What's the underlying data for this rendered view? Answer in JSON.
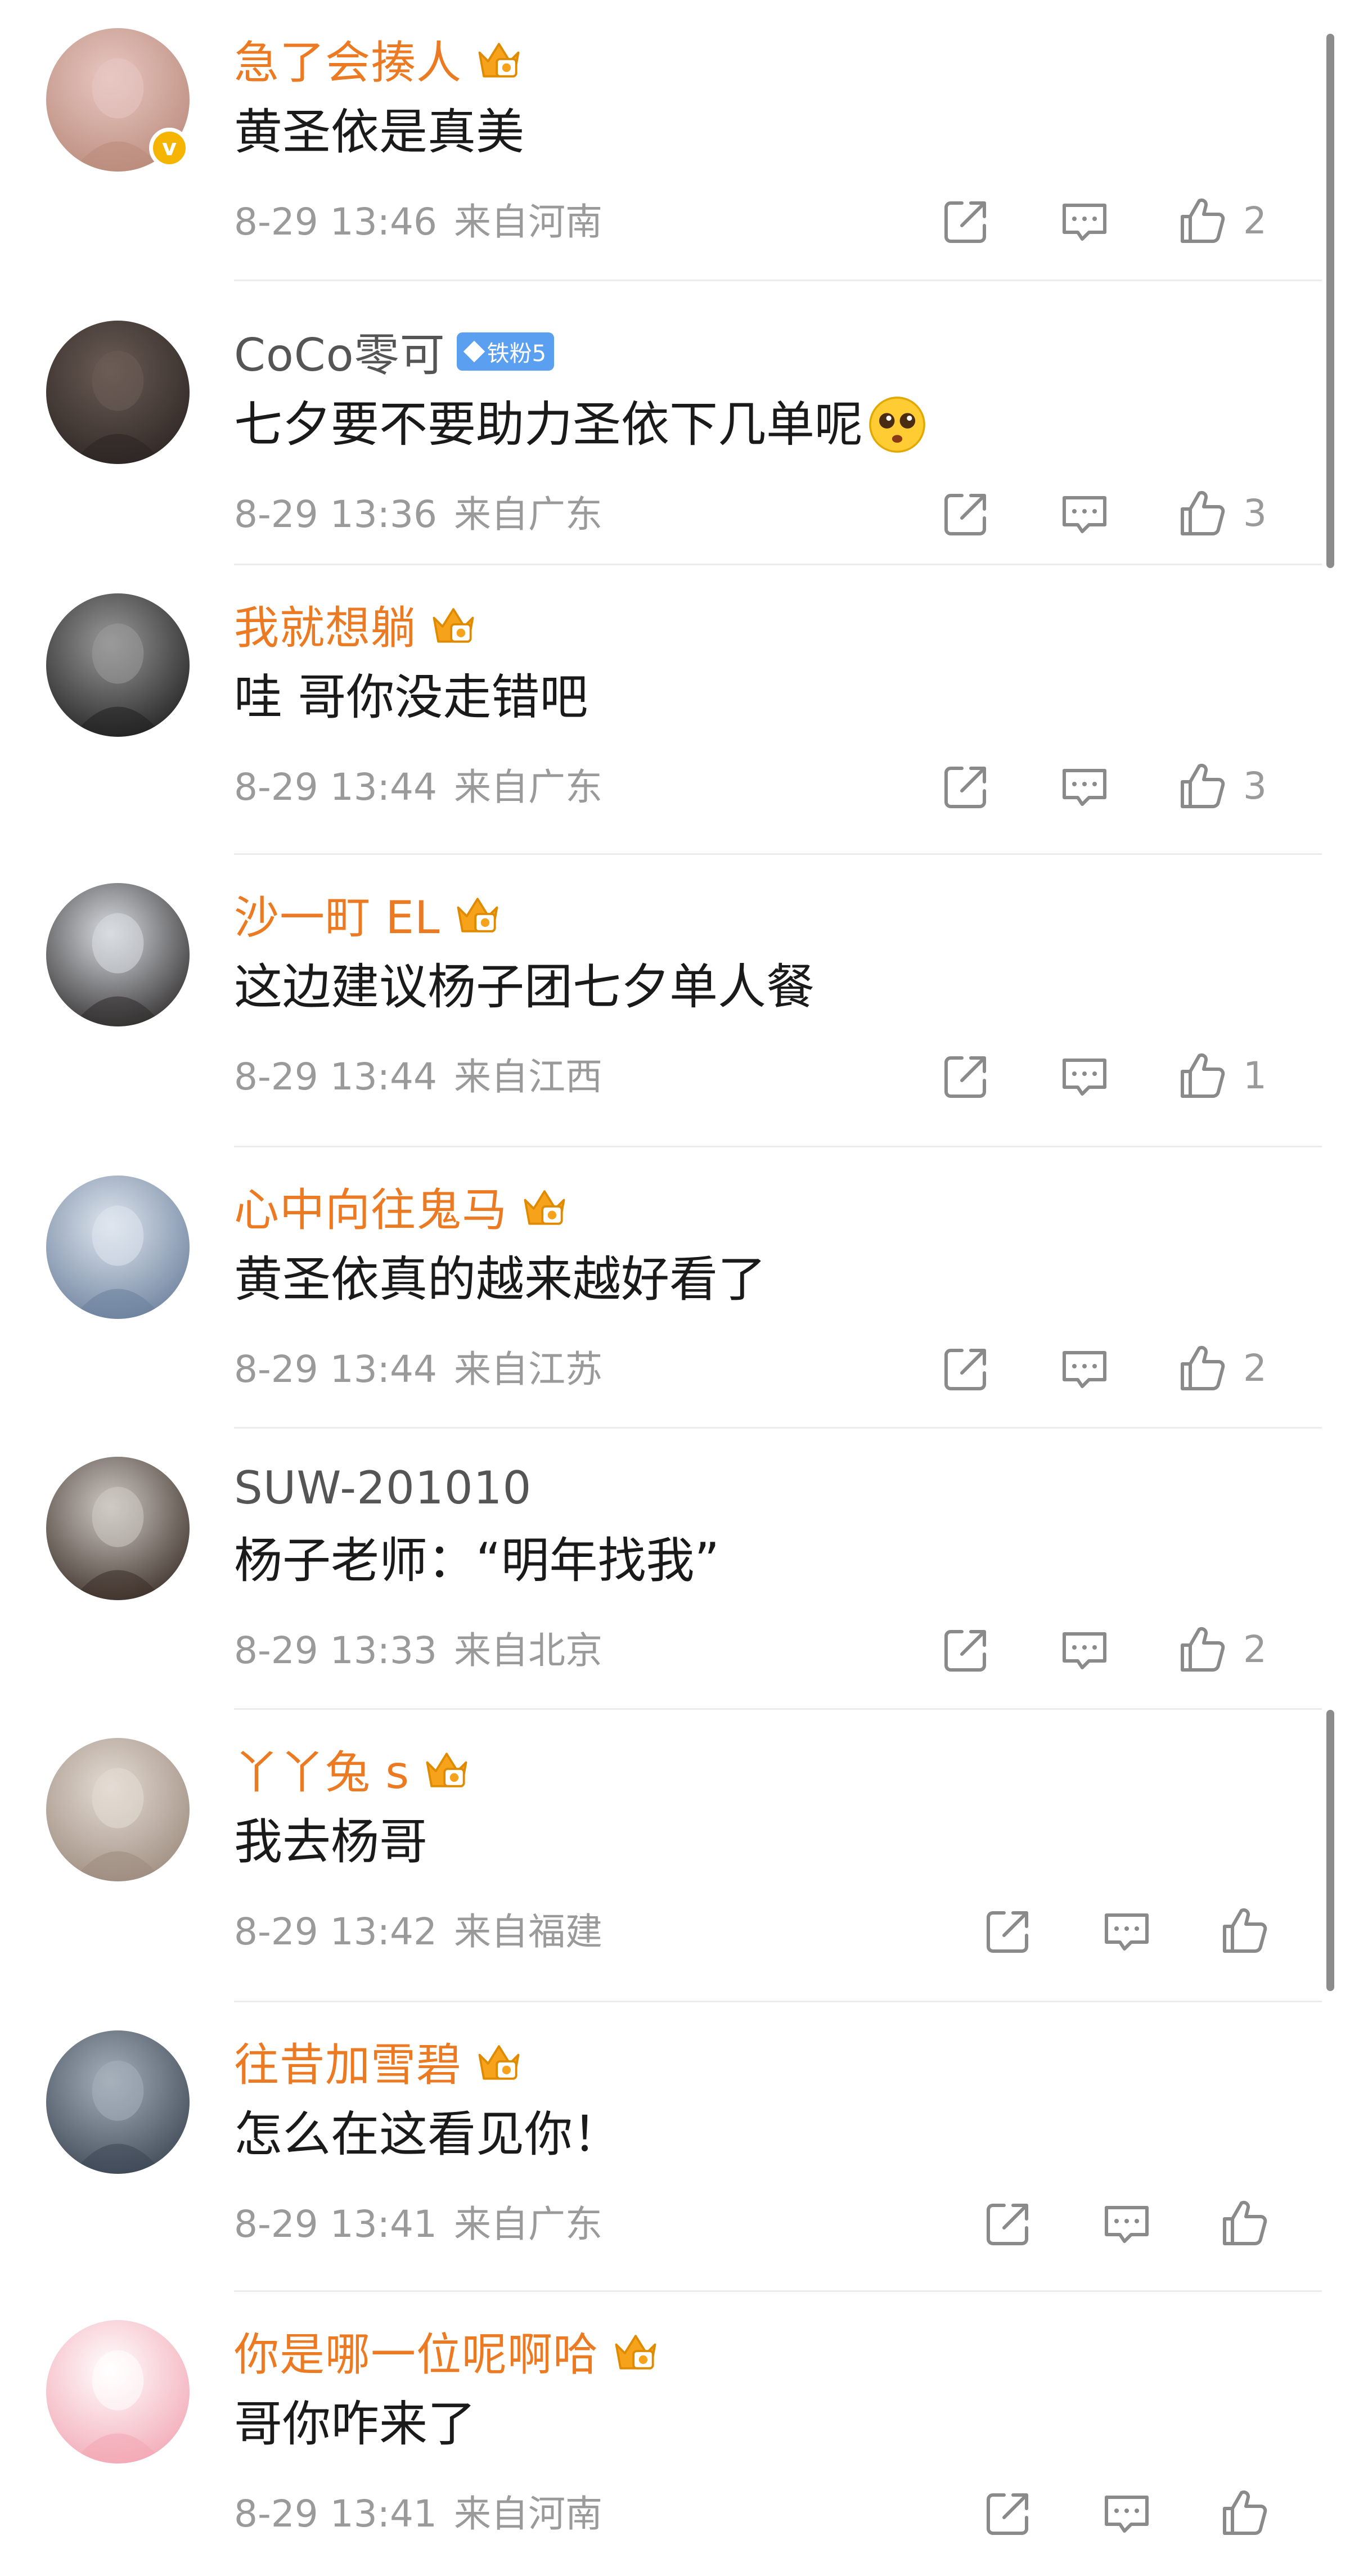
{
  "comments": [
    {
      "username": "急了会揍人",
      "name_style": "vip",
      "badge": "crown",
      "verified": true,
      "text": "黄圣依是真美",
      "time": "8-29 13:46",
      "location": "来自河南",
      "likes": "2",
      "avatar_colors": [
        "#e8c7c2",
        "#b98a7a"
      ]
    },
    {
      "username": "CoCo零可",
      "name_style": "plain",
      "badge": "fan",
      "fan_badge_label": "铁粉5",
      "verified": false,
      "text": "七夕要不要助力圣依下几单呢",
      "emoji": "pleading-face-emoji",
      "time": "8-29 13:36",
      "location": "来自广东",
      "likes": "3",
      "avatar_colors": [
        "#6b5c55",
        "#2c2523"
      ]
    },
    {
      "username": "我就想躺",
      "name_style": "vip",
      "badge": "crown",
      "verified": false,
      "text": "哇  哥你没走错吧",
      "time": "8-29 13:44",
      "location": "来自广东",
      "likes": "3",
      "avatar_colors": [
        "#9a9a9a",
        "#1f1f1f"
      ]
    },
    {
      "username": "沙一町 EL",
      "name_style": "vip",
      "badge": "crown",
      "verified": false,
      "text": "这边建议杨子团七夕单人餐",
      "time": "8-29 13:44",
      "location": "来自江西",
      "likes": "1",
      "avatar_colors": [
        "#d9dde2",
        "#2d2a2a"
      ]
    },
    {
      "username": "心中向往鬼马",
      "name_style": "vip",
      "badge": "crown",
      "verified": false,
      "text": "黄圣依真的越来越好看了",
      "time": "8-29 13:44",
      "location": "来自江苏",
      "likes": "2",
      "avatar_colors": [
        "#dfe6ee",
        "#6a7f9c"
      ]
    },
    {
      "username": "SUW-201010",
      "name_style": "plain",
      "badge": "none",
      "verified": false,
      "text": "杨子老师：“明年找我”",
      "time": "8-29 13:33",
      "location": "来自北京",
      "likes": "2",
      "avatar_colors": [
        "#cfcac4",
        "#3a2d27"
      ]
    },
    {
      "username": "丫丫兔 s",
      "name_style": "vip",
      "badge": "crown",
      "verified": false,
      "text": "我去杨哥",
      "time": "8-29 13:42",
      "location": "来自福建",
      "likes": "",
      "avatar_colors": [
        "#e4dcd4",
        "#9c8a7d"
      ]
    },
    {
      "username": "往昔加雪碧",
      "name_style": "vip",
      "badge": "crown",
      "verified": false,
      "text": "怎么在这看见你！",
      "time": "8-29 13:41",
      "location": "来自广东",
      "likes": "",
      "avatar_colors": [
        "#a6b0bb",
        "#3c4653"
      ]
    },
    {
      "username": "你是哪一位呢啊哈",
      "name_style": "vip",
      "badge": "crown",
      "verified": false,
      "text": "哥你咋来了",
      "time": "8-29 13:41",
      "location": "来自河南",
      "likes": "",
      "avatar_colors": [
        "#ffffff",
        "#f2a6b3"
      ]
    }
  ],
  "colors": {
    "vip_name": "#ec7a22",
    "plain_name": "#555555",
    "meta_text": "#9a9a9a",
    "body_text": "#1a1a1a",
    "fan_badge": "#5a9ff0",
    "verified": "#f5b400"
  }
}
